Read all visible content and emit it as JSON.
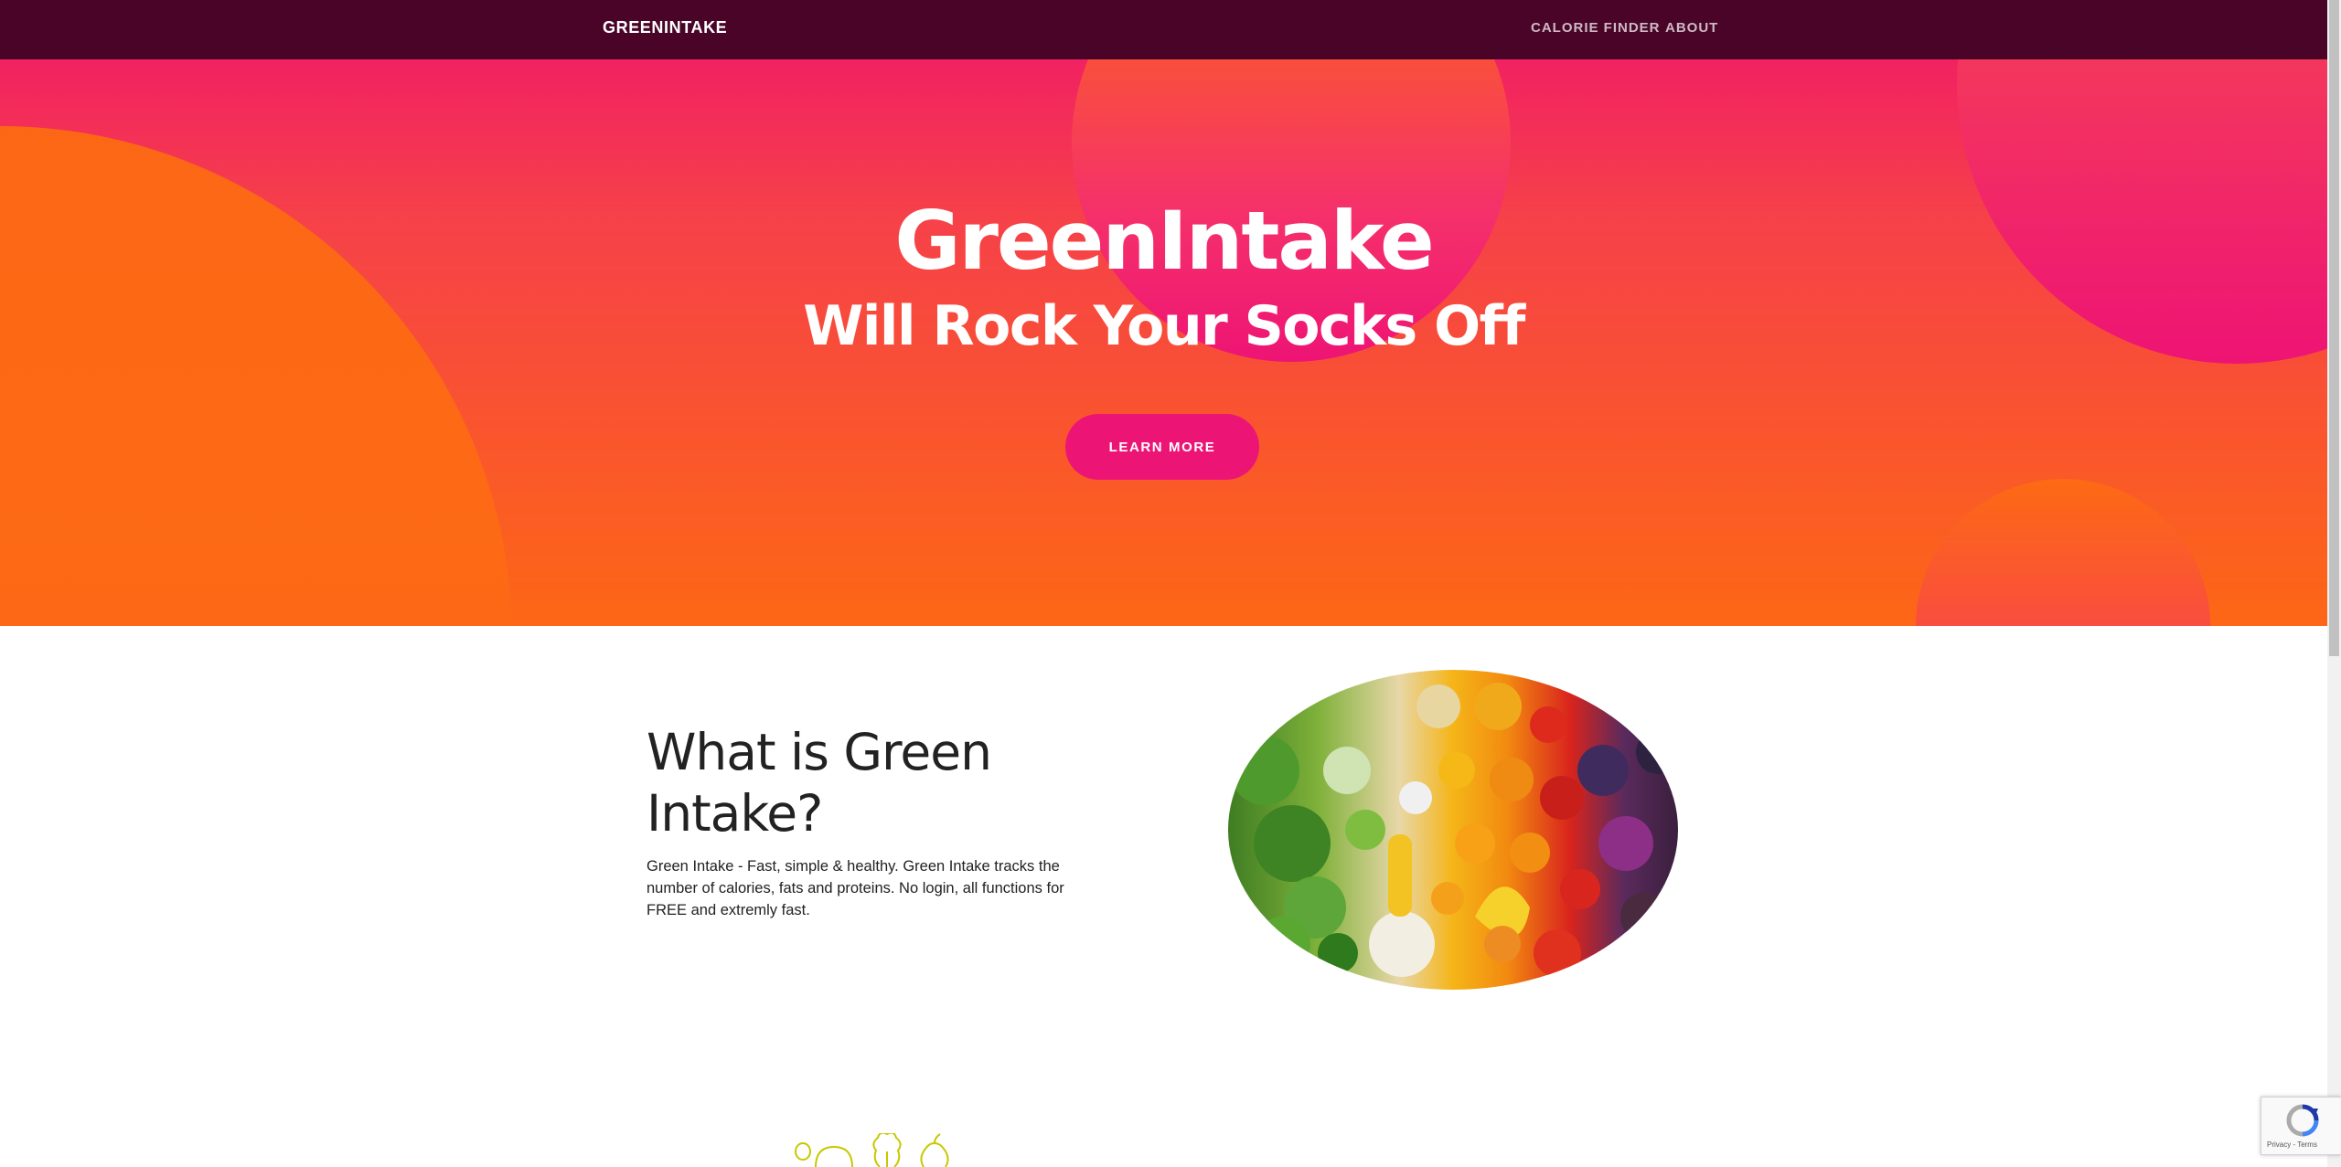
{
  "navbar": {
    "brand": "GREENINTAKE",
    "links": [
      {
        "label": "CALORIE FINDER"
      },
      {
        "label": "ABOUT"
      }
    ]
  },
  "hero": {
    "title": "GreenIntake",
    "subtitle": "Will Rock Your Socks Off",
    "button_label": "LEARN MORE"
  },
  "about": {
    "heading": "What is Green Intake?",
    "body": "Green Intake - Fast, simple & healthy. Green Intake tracks the number of calories, fats and proteins. No login, all functions for FREE and extremly fast."
  },
  "recaptcha": {
    "footer": "Privacy - Terms"
  },
  "colors": {
    "navbar": "#4a0428",
    "hero_top": "#f0166b",
    "hero_bottom": "#fd6715",
    "button": "#ec1575",
    "icon_stroke": "#c8c800"
  },
  "icons": [
    "vegetable-bowl-image",
    "fruit-line-icons",
    "recaptcha-icon"
  ]
}
